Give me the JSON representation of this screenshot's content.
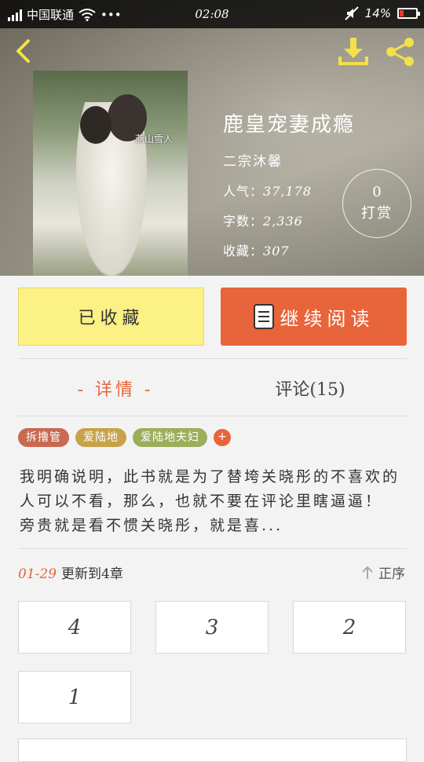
{
  "status_bar": {
    "carrier": "中国联通",
    "time": "02:08",
    "battery": "14%",
    "battery_level": 0.14,
    "dots": "•••"
  },
  "header": {
    "back_icon": "chevron-left-icon",
    "download_icon": "download-icon",
    "share_icon": "share-icon"
  },
  "book": {
    "title": "鹿皇宠妻成瘾",
    "author": "二宗沐馨",
    "popularity_label": "人气：",
    "popularity": "37,178",
    "words_label": "字数：",
    "words": "2,336",
    "favorites_label": "收藏：",
    "favorites": "307",
    "tip_count": "0",
    "tip_label": "打赏",
    "cover_logo": "燕山雪人"
  },
  "actions": {
    "collected_label": "已收藏",
    "continue_label": "继续阅读"
  },
  "tabs": {
    "detail": "- 详情 -",
    "comments": "评论(15)"
  },
  "tags": [
    {
      "label": "拆撸管",
      "color": "#c9694f"
    },
    {
      "label": "爱陆地",
      "color": "#c8a24a"
    },
    {
      "label": "爱陆地夫妇",
      "color": "#9cae5a"
    }
  ],
  "tag_add": "+",
  "description": "我明确说明，此书就是为了替垮关晓彤的不喜欢的人可以不看，那么，也就不要在评论里瞎逼逼！ 旁贵就是看不惯关晓彤，就是喜...",
  "update": {
    "date": "01-29",
    "text": "更新到4章",
    "sort_label": "正序"
  },
  "chapters": [
    "4",
    "3",
    "2",
    "1"
  ],
  "colors": {
    "accent": "#e8643a",
    "collected_bg": "#fbf185"
  }
}
